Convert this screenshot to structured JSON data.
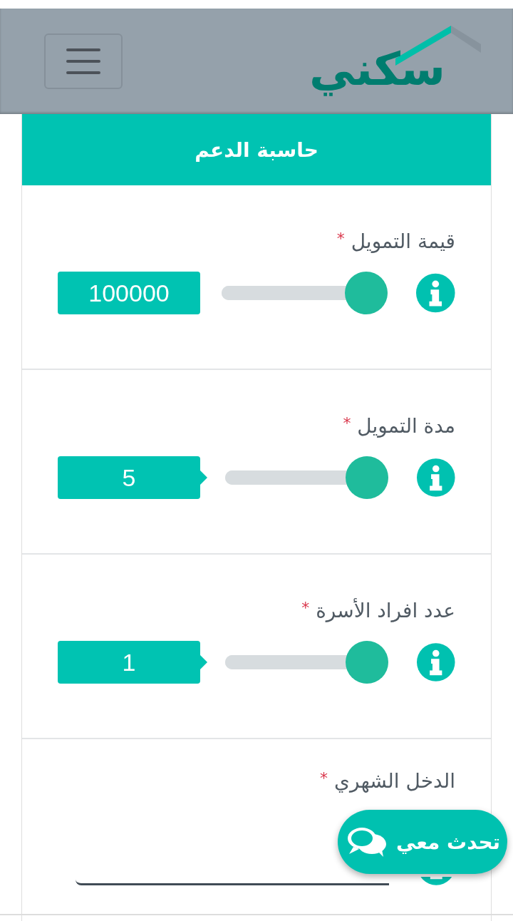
{
  "header": {
    "logo": "سكني"
  },
  "card": {
    "title": "حاسبة الدعم",
    "fields": [
      {
        "kind": "slider",
        "label": "قيمة التمويل",
        "required_mark": "*",
        "value": "100000",
        "level": 1,
        "pointer": false
      },
      {
        "kind": "slider",
        "label": "مدة التمويل",
        "required_mark": "*",
        "value": "5",
        "level": 1,
        "pointer": true
      },
      {
        "kind": "slider",
        "label": "عدد افراد الأسرة",
        "required_mark": "*",
        "value": "1",
        "level": 1,
        "pointer": true
      },
      {
        "kind": "input",
        "label": "الدخل الشهري",
        "required_mark": "*"
      }
    ]
  },
  "chat_button": {
    "label": "تحدث معي"
  }
}
